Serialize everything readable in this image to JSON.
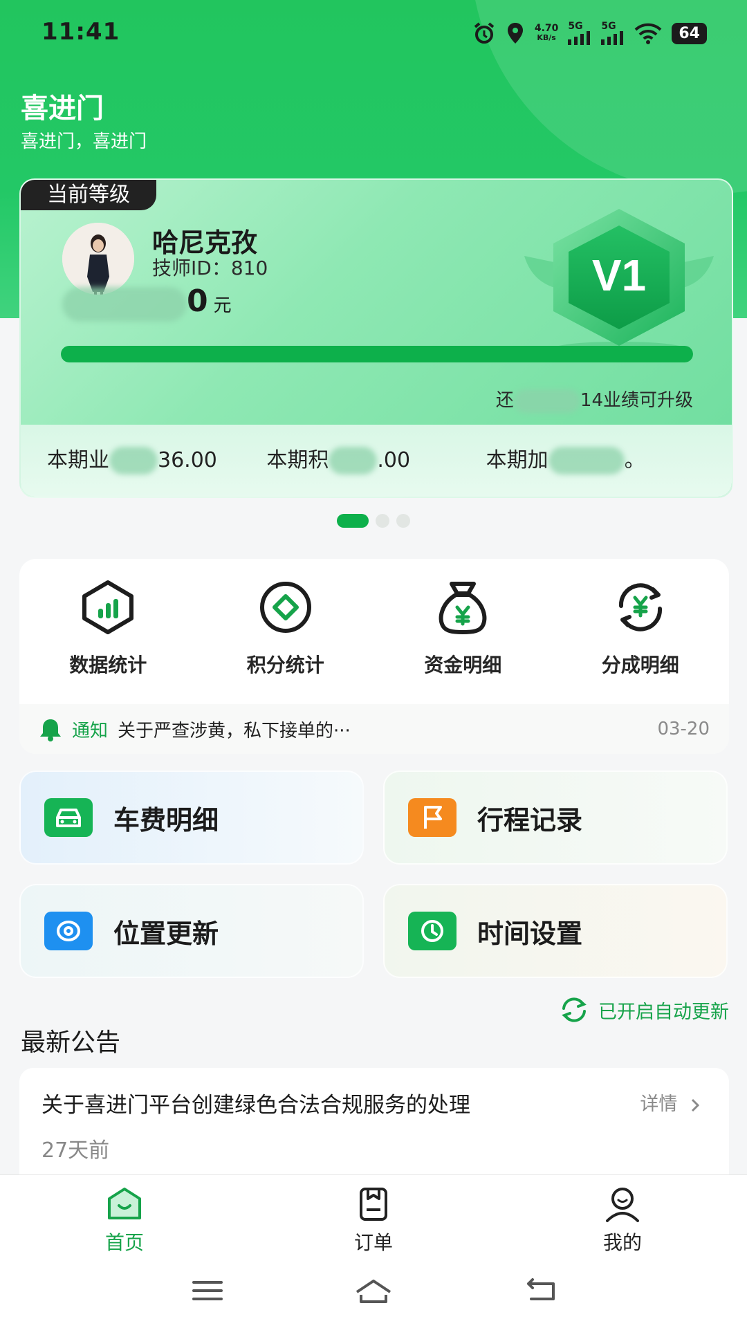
{
  "status_bar": {
    "time": "11:41",
    "net_speed": "4.70",
    "net_unit": "KB/s",
    "sim1": "5G",
    "sim2": "5G",
    "battery": "64"
  },
  "header": {
    "title": "喜进门",
    "subtitle": "喜进门，喜进门"
  },
  "level_card": {
    "tag": "当前等级",
    "name": "哈尼克孜",
    "tech_id": "技师ID：810",
    "amount_tail": "0",
    "amount_unit": "元",
    "badge_level": "V1",
    "progress": 1.0,
    "upgrade_prefix": "还",
    "upgrade_suffix": "14业绩可升级",
    "period_items": [
      {
        "prefix": "本期业",
        "suffix": "36.00"
      },
      {
        "prefix": "本期积",
        "suffix": ".00"
      },
      {
        "prefix": "本期加",
        "suffix": "。"
      }
    ]
  },
  "carousel": {
    "count": 3,
    "active": 0
  },
  "tools": [
    {
      "label": "数据统计",
      "icon": "data-stats-icon"
    },
    {
      "label": "积分统计",
      "icon": "points-stats-icon"
    },
    {
      "label": "资金明细",
      "icon": "money-bag-icon"
    },
    {
      "label": "分成明细",
      "icon": "revenue-share-icon"
    }
  ],
  "notice": {
    "tag": "通知",
    "text": "关于严查涉黄，私下接单的···",
    "date": "03-20"
  },
  "tiles": [
    {
      "label": "车费明细",
      "icon": "car-icon",
      "color": "#16b455"
    },
    {
      "label": "行程记录",
      "icon": "flag-icon",
      "color": "#f58a1f"
    },
    {
      "label": "位置更新",
      "icon": "location-icon",
      "color": "#1e90f0"
    },
    {
      "label": "时间设置",
      "icon": "clock-icon",
      "color": "#16b455"
    }
  ],
  "auto_update": "已开启自动更新",
  "announcements": {
    "title": "最新公告",
    "items": [
      {
        "title": "关于喜进门平台创建绿色合法合规服务的处理",
        "more": "详情",
        "time": "27天前"
      }
    ]
  },
  "bottom_nav": [
    {
      "label": "首页",
      "active": true
    },
    {
      "label": "订单",
      "active": false
    },
    {
      "label": "我的",
      "active": false
    }
  ],
  "colors": {
    "brand_green": "#16a34a",
    "header_green": "#22c55e",
    "progress_green": "#0db04b"
  }
}
